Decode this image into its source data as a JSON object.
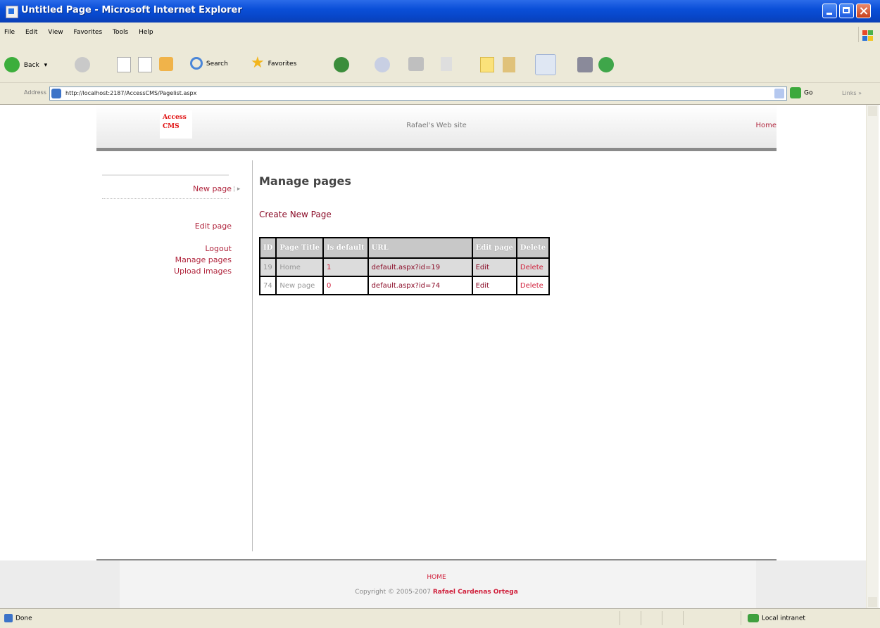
{
  "window": {
    "title": "Untitled Page - Microsoft Internet Explorer"
  },
  "menu": [
    "File",
    "Edit",
    "View",
    "Favorites",
    "Tools",
    "Help"
  ],
  "toolbar": {
    "back": "Back",
    "search": "Search",
    "favorites": "Favorites"
  },
  "address": {
    "label": "Address",
    "url": "http://localhost:2187/AccessCMS/Pagelist.aspx",
    "go": "Go",
    "links": "Links"
  },
  "site": {
    "logo_line1": "Access",
    "logo_line2": "CMS",
    "name": "Rafael's Web site",
    "home_link": "Home"
  },
  "sidebar": {
    "new_page": "New page",
    "edit_page": "Edit page",
    "logout": "Logout",
    "manage_pages": "Manage pages",
    "upload_images": "Upload images"
  },
  "main": {
    "heading": "Manage pages",
    "create_link": "Create New Page"
  },
  "table": {
    "headers": [
      "ID",
      "Page Title",
      "Is default",
      "URL",
      "Edit page",
      "Delete"
    ],
    "rows": [
      {
        "id": "19",
        "title": "Home",
        "is_default": "1",
        "url": "default.aspx?id=19",
        "edit": "Edit",
        "delete": "Delete"
      },
      {
        "id": "74",
        "title": "New page",
        "is_default": "0",
        "url": "default.aspx?id=74",
        "edit": "Edit",
        "delete": "Delete"
      }
    ]
  },
  "footer": {
    "home": "HOME",
    "copyright_prefix": "Copyright © 2005-2007",
    "author": "Rafael Cardenas Ortega"
  },
  "status": {
    "done": "Done",
    "zone": "Local intranet"
  }
}
